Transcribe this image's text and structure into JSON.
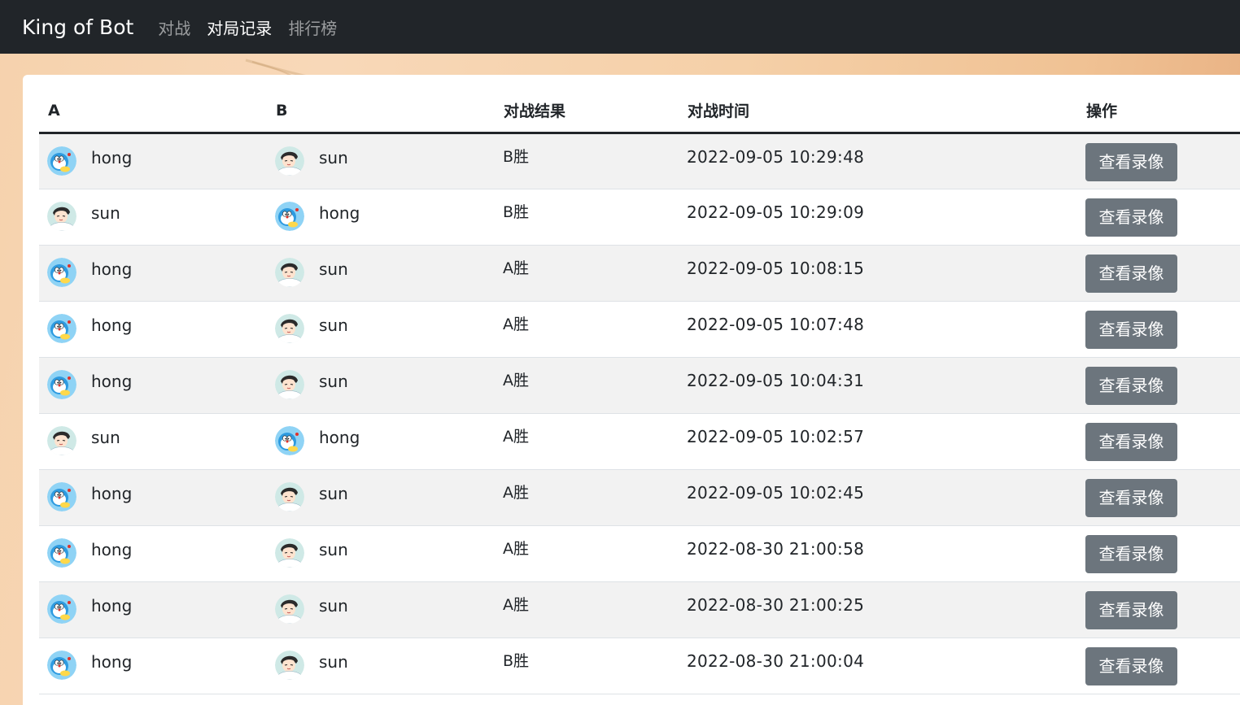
{
  "navbar": {
    "brand": "King of Bot",
    "items": [
      {
        "label": "对战",
        "active": false
      },
      {
        "label": "对局记录",
        "active": true
      },
      {
        "label": "排行榜",
        "active": false
      }
    ]
  },
  "table": {
    "headers": [
      "A",
      "B",
      "对战结果",
      "对战时间",
      "操作"
    ],
    "button_label": "查看录像",
    "rows": [
      {
        "a": "hong",
        "a_avatar": "doraemon-avatar",
        "b": "sun",
        "b_avatar": "anime-boy-avatar",
        "result": "B胜",
        "time": "2022-09-05 10:29:48"
      },
      {
        "a": "sun",
        "a_avatar": "anime-boy-avatar",
        "b": "hong",
        "b_avatar": "doraemon-avatar",
        "result": "B胜",
        "time": "2022-09-05 10:29:09"
      },
      {
        "a": "hong",
        "a_avatar": "doraemon-avatar",
        "b": "sun",
        "b_avatar": "anime-boy-avatar",
        "result": "A胜",
        "time": "2022-09-05 10:08:15"
      },
      {
        "a": "hong",
        "a_avatar": "doraemon-avatar",
        "b": "sun",
        "b_avatar": "anime-boy-avatar",
        "result": "A胜",
        "time": "2022-09-05 10:07:48"
      },
      {
        "a": "hong",
        "a_avatar": "doraemon-avatar",
        "b": "sun",
        "b_avatar": "anime-boy-avatar",
        "result": "A胜",
        "time": "2022-09-05 10:04:31"
      },
      {
        "a": "sun",
        "a_avatar": "anime-boy-avatar",
        "b": "hong",
        "b_avatar": "doraemon-avatar",
        "result": "A胜",
        "time": "2022-09-05 10:02:57"
      },
      {
        "a": "hong",
        "a_avatar": "doraemon-avatar",
        "b": "sun",
        "b_avatar": "anime-boy-avatar",
        "result": "A胜",
        "time": "2022-09-05 10:02:45"
      },
      {
        "a": "hong",
        "a_avatar": "doraemon-avatar",
        "b": "sun",
        "b_avatar": "anime-boy-avatar",
        "result": "A胜",
        "time": "2022-08-30 21:00:58"
      },
      {
        "a": "hong",
        "a_avatar": "doraemon-avatar",
        "b": "sun",
        "b_avatar": "anime-boy-avatar",
        "result": "A胜",
        "time": "2022-08-30 21:00:25"
      },
      {
        "a": "hong",
        "a_avatar": "doraemon-avatar",
        "b": "sun",
        "b_avatar": "anime-boy-avatar",
        "result": "B胜",
        "time": "2022-08-30 21:00:04"
      }
    ]
  },
  "colors": {
    "navbar_bg": "#212529",
    "button_bg": "#6c757d",
    "stripe_bg": "#f2f2f2",
    "page_bg": "#f6d2ad"
  }
}
